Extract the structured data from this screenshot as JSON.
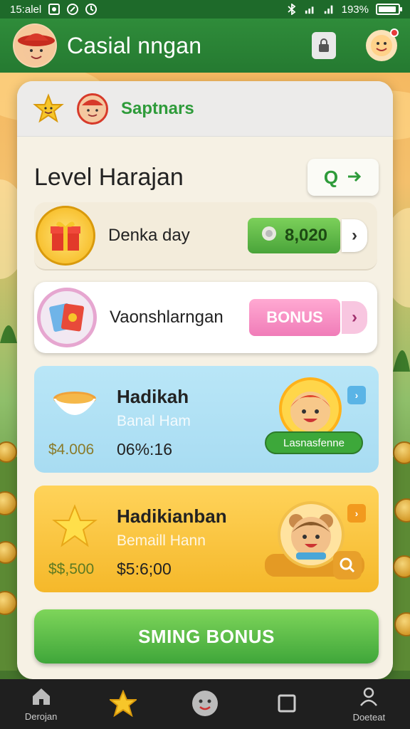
{
  "status_bar": {
    "time": "15:alel",
    "battery_percent": "193%",
    "battery_level": 0.93
  },
  "app_bar": {
    "title": "Casial nngan"
  },
  "card": {
    "header_name": "Saptnars",
    "level_title": "Level Harajan",
    "level_button_label": "Q"
  },
  "rows": [
    {
      "label": "Denka day",
      "badge": "8,020"
    },
    {
      "label": "Vaonshlarngan",
      "badge": "BONUS"
    }
  ],
  "promos": [
    {
      "title": "Hadikah",
      "subtitle": "Banal Ham",
      "amount": "$4.006",
      "time": "06%:16",
      "tag": "Lasnasfenne"
    },
    {
      "title": "Hadikianban",
      "subtitle": "Bemaill Hann",
      "amount": "$$,500",
      "time": "$5:6;00"
    }
  ],
  "bonus_button": {
    "label": "SMING BONUS"
  },
  "bottom_nav": [
    {
      "label": "Derojan",
      "icon": "home-icon"
    },
    {
      "label": "",
      "icon": "star-icon"
    },
    {
      "label": "",
      "icon": "face-icon"
    },
    {
      "label": "",
      "icon": "square-icon"
    },
    {
      "label": "Doeteat",
      "icon": "profile-icon"
    }
  ],
  "colors": {
    "brand_green": "#2f8c3a",
    "accent_pink": "#f07cb8",
    "promo_blue": "#b9e6f7",
    "promo_yellow": "#ffd35a"
  }
}
